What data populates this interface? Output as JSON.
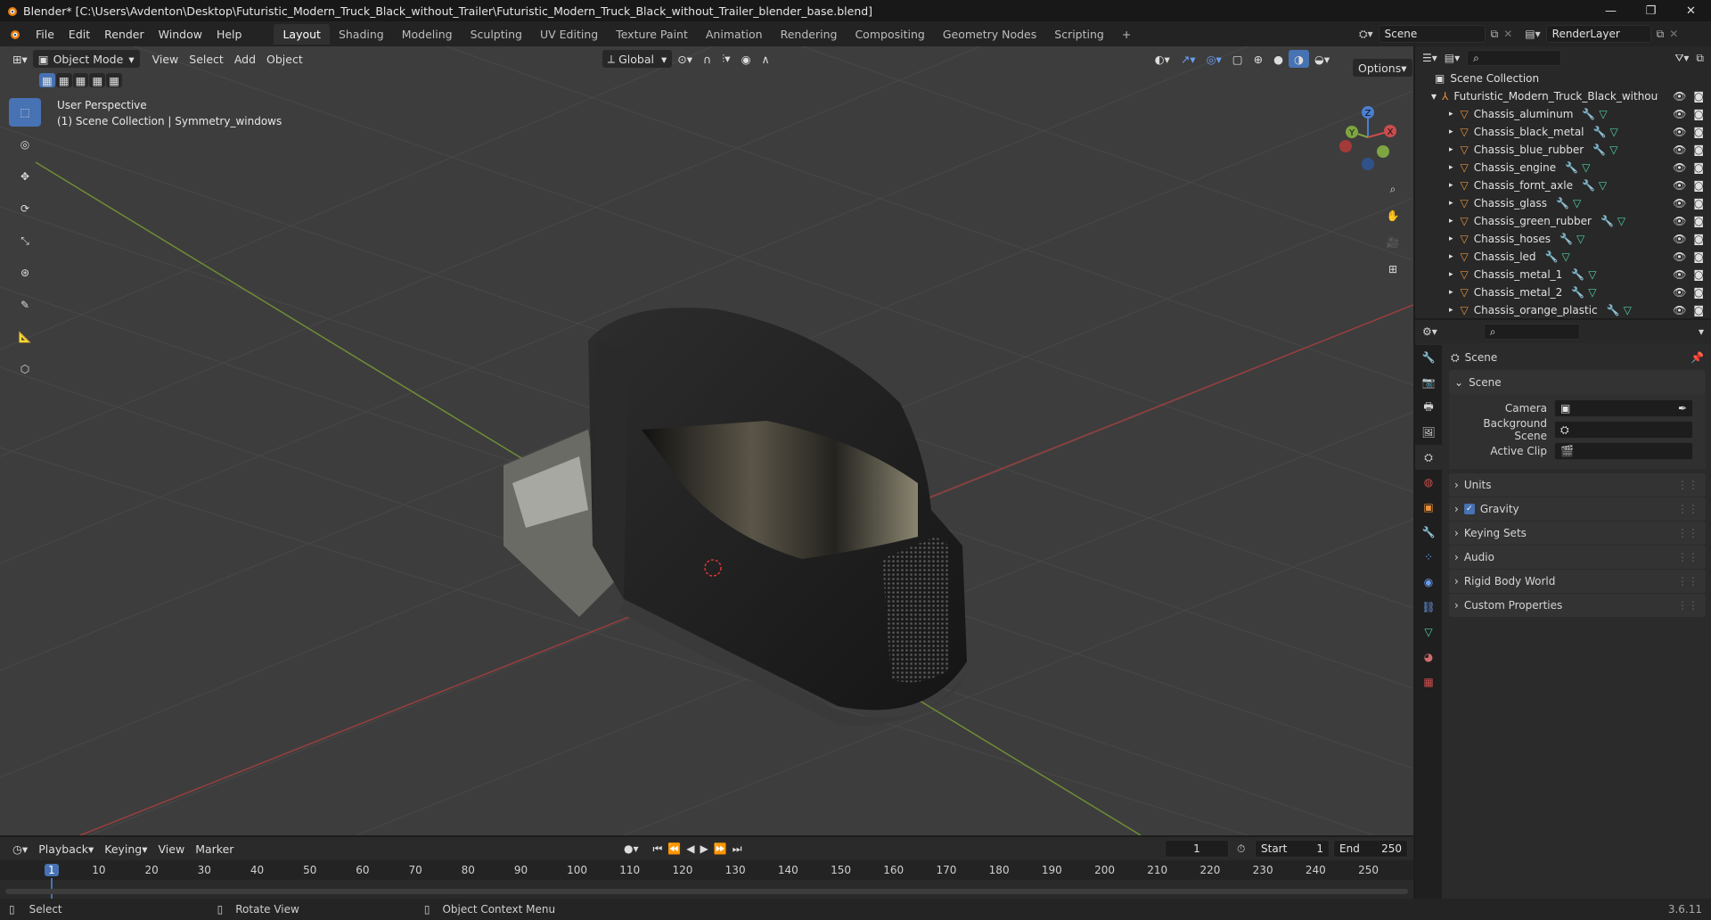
{
  "window": {
    "title": "Blender* [C:\\Users\\Avdenton\\Desktop\\Futuristic_Modern_Truck_Black_without_Trailer\\Futuristic_Modern_Truck_Black_without_Trailer_blender_base.blend]",
    "minimize": "—",
    "maximize": "❐",
    "close": "✕"
  },
  "menu": [
    "File",
    "Edit",
    "Render",
    "Window",
    "Help"
  ],
  "workspaces": [
    "Layout",
    "Shading",
    "Modeling",
    "Sculpting",
    "UV Editing",
    "Texture Paint",
    "Animation",
    "Rendering",
    "Compositing",
    "Geometry Nodes",
    "Scripting"
  ],
  "workspace_add": "+",
  "scene_field": "Scene",
  "view_layer_field": "RenderLayer",
  "viewport": {
    "mode": "Object Mode",
    "menus": [
      "View",
      "Select",
      "Add",
      "Object"
    ],
    "orientation": "Global",
    "options": "Options",
    "overlay_line1": "User Perspective",
    "overlay_line2": "(1) Scene Collection | Symmetry_windows",
    "gizmo": {
      "x": "X",
      "y": "Y",
      "z": "Z"
    }
  },
  "outliner": {
    "root": "Scene Collection",
    "collection": "Futuristic_Modern_Truck_Black_without",
    "objects": [
      "Chassis_aluminum",
      "Chassis_black_metal",
      "Chassis_blue_rubber",
      "Chassis_engine",
      "Chassis_fornt_axle",
      "Chassis_glass",
      "Chassis_green_rubber",
      "Chassis_hoses",
      "Chassis_led",
      "Chassis_metal_1",
      "Chassis_metal_2",
      "Chassis_orange_plastic"
    ]
  },
  "properties": {
    "context": "Scene",
    "section": "Scene",
    "camera_label": "Camera",
    "background_label": "Background Scene",
    "clip_label": "Active Clip",
    "subpanels": [
      "Units",
      "Gravity",
      "Keying Sets",
      "Audio",
      "Rigid Body World",
      "Custom Properties"
    ],
    "gravity_checked": true
  },
  "timeline": {
    "menus": [
      "Playback",
      "Keying",
      "View",
      "Marker"
    ],
    "current_frame": "1",
    "start_label": "Start",
    "start": "1",
    "end_label": "End",
    "end": "250",
    "ruler": [
      "1",
      "10",
      "20",
      "30",
      "40",
      "50",
      "60",
      "70",
      "80",
      "90",
      "100",
      "110",
      "120",
      "130",
      "140",
      "150",
      "160",
      "170",
      "180",
      "190",
      "200",
      "210",
      "220",
      "230",
      "240",
      "250"
    ]
  },
  "status": {
    "select": "Select",
    "rotate": "Rotate View",
    "context_menu": "Object Context Menu",
    "version": "3.6.11"
  },
  "colors": {
    "accent": "#4772b3",
    "object_orange": "#e8913c",
    "modifier_blue": "#6b9ef0",
    "mesh_green": "#4fd1a2",
    "x_axis": "#c94d4d",
    "y_axis": "#7ea542"
  }
}
